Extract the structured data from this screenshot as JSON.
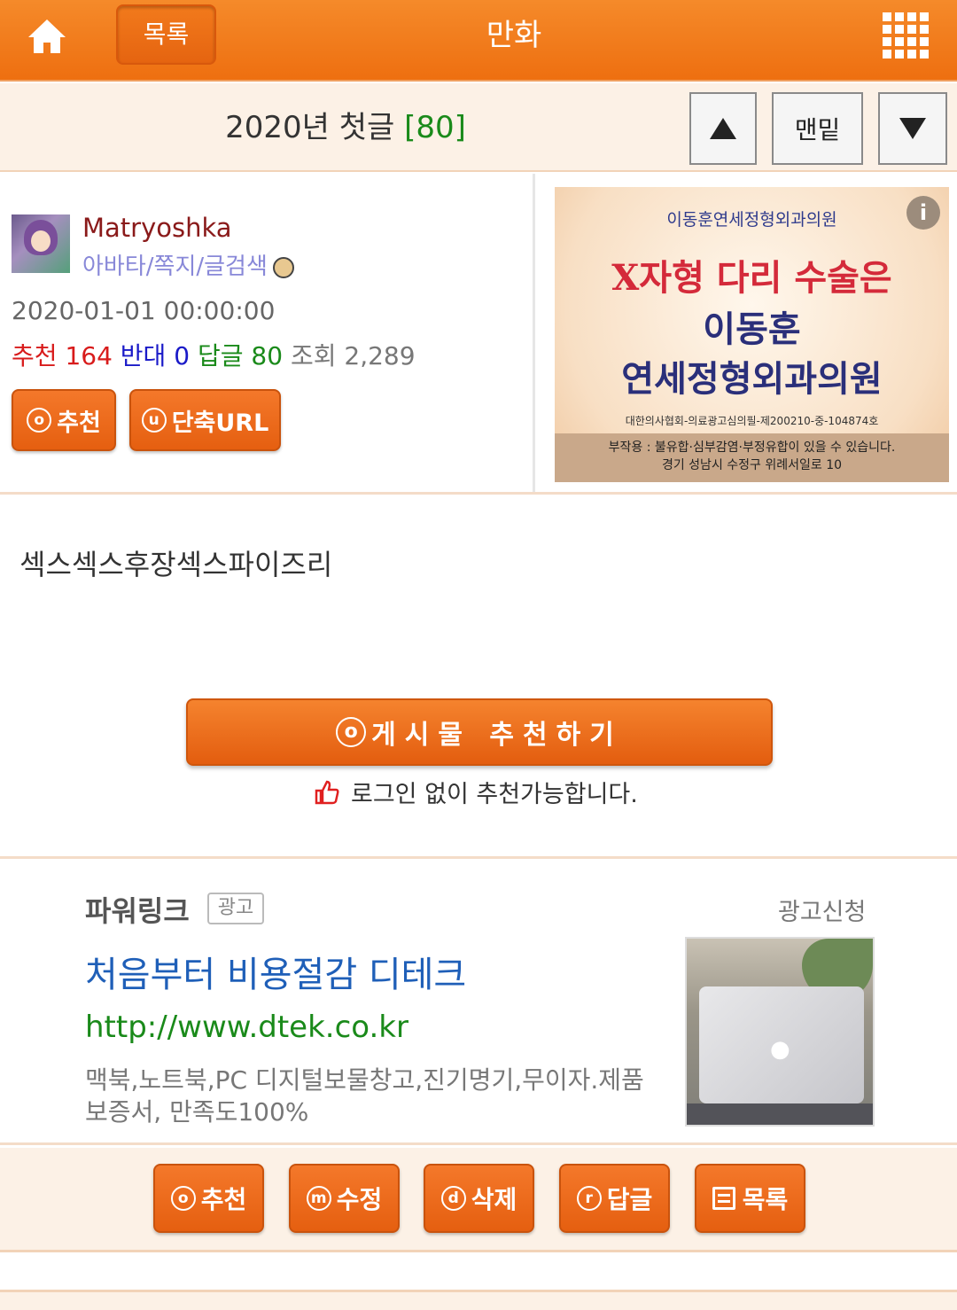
{
  "header": {
    "list_label": "목록",
    "title": "만화"
  },
  "title_bar": {
    "title": "2020년 첫글 ",
    "reply_count": "[80]",
    "bottom_label": "맨밑"
  },
  "author": {
    "name": "Matryoshka",
    "links": "아바타/쪽지/글검색",
    "date": "2020-01-01 00:00:00",
    "stats": {
      "rec_label": "추천",
      "rec_value": "164",
      "opp_label": "반대",
      "opp_value": "0",
      "reply_label": "답글",
      "reply_value": "80",
      "view_label": "조회",
      "view_value": "2,289"
    },
    "recommend_btn": "추천",
    "recommend_icon": "o",
    "shorturl_btn": "단축URL",
    "shorturl_icon": "u"
  },
  "ad_banner": {
    "info_icon": "i",
    "clinic": "이동훈연세정형외과의원",
    "line1": "X자형 다리 수술은",
    "line2": "이동훈",
    "line3": "연세정형외과의원",
    "registration": "대한의사협회-의료광고심의필-제200210-중-104874호",
    "side_effect": "부작용 : 불유합·심부감염·부정유합이 있을 수 있습니다.",
    "address": "경기 성남시 수정구 위례서일로 10"
  },
  "post": {
    "body": "섹스섹스후장섹스파이즈리"
  },
  "big_recommend": {
    "icon": "o",
    "label": "게시물  추천하기",
    "note": "로그인 없이 추천가능합니다."
  },
  "powerlink": {
    "label": "파워링크",
    "ad_tag": "광고",
    "apply": "광고신청",
    "title": "처음부터 비용절감 디테크",
    "url": "http://www.dtek.co.kr",
    "description": "맥북,노트북,PC 디지털보물창고,진기명기,무이자.제품보증서, 만족도100%"
  },
  "actions": [
    {
      "icon": "o",
      "label": "추천"
    },
    {
      "icon": "m",
      "label": "수정"
    },
    {
      "icon": "d",
      "label": "삭제"
    },
    {
      "icon": "r",
      "label": "답글"
    },
    {
      "icon": "list",
      "label": "목록"
    }
  ],
  "colors": {
    "accent": "#ee6f10",
    "recommend": "#d81b1b",
    "oppose": "#1a1ac8",
    "reply": "#1a8a1a",
    "link": "#1f5fb8"
  }
}
